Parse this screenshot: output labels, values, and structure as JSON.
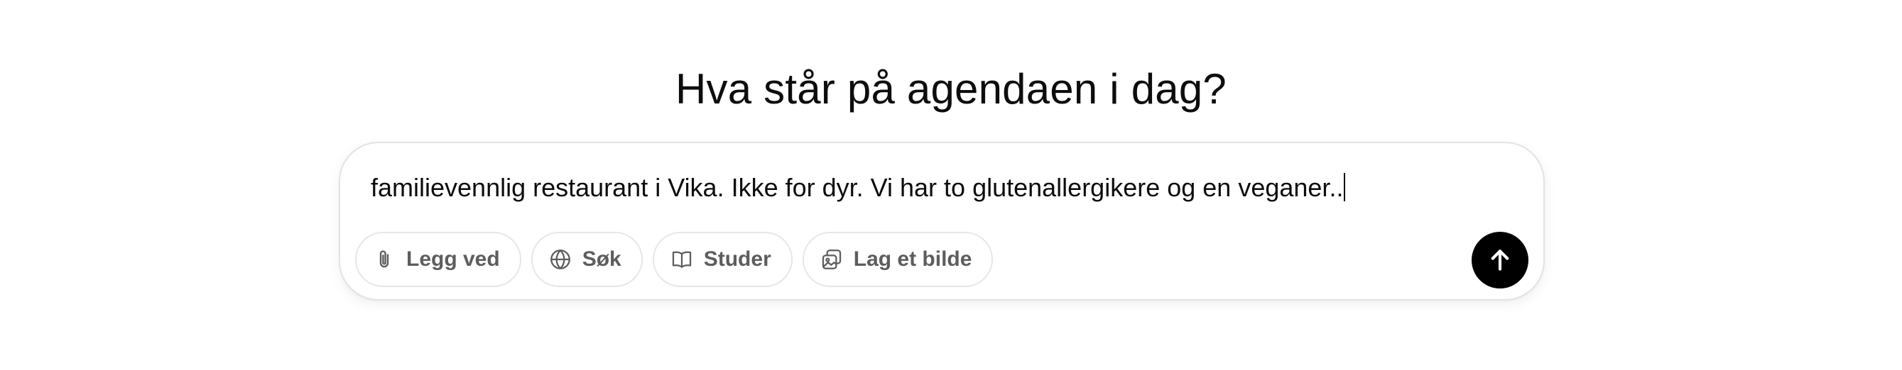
{
  "header": {
    "title": "Hva står på agendaen i dag?"
  },
  "composer": {
    "text": "familievennlig restaurant i Vika. Ikke for dyr. Vi har to glutenallergikere og en veganer..",
    "tools": [
      {
        "label": "Legg ved",
        "icon": "paperclip-icon"
      },
      {
        "label": "Søk",
        "icon": "globe-icon"
      },
      {
        "label": "Studer",
        "icon": "book-icon"
      },
      {
        "label": "Lag et bilde",
        "icon": "image-icon"
      }
    ],
    "send_icon": "arrow-up-icon"
  },
  "colors": {
    "text": "#0d0d0d",
    "tool_text": "#5d5d5d",
    "border": "#e3e3e3",
    "send_bg": "#000000",
    "send_icon": "#ffffff"
  }
}
